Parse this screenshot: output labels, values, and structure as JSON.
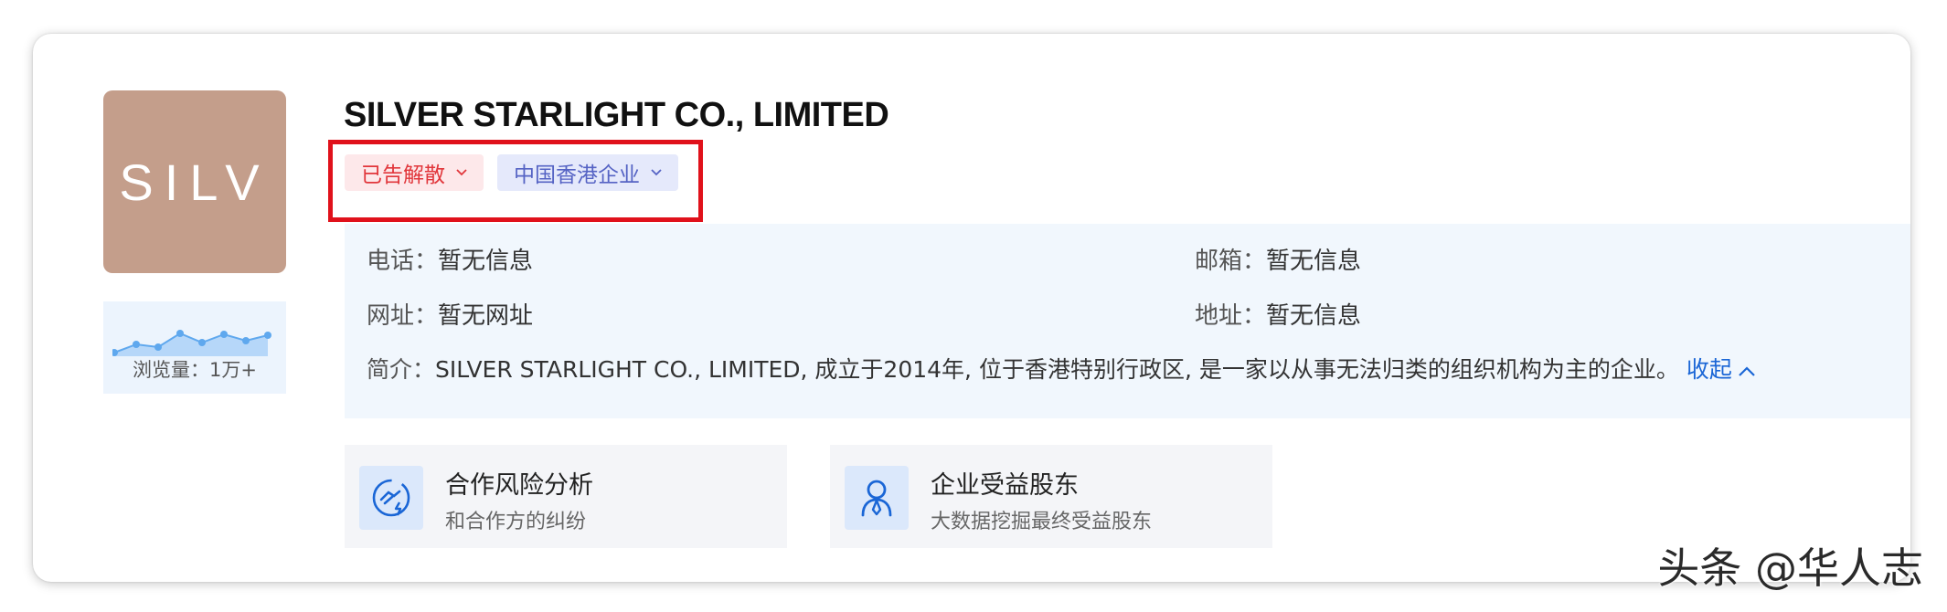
{
  "logo": {
    "text": "SILV",
    "color": "#c49e8b"
  },
  "views": {
    "label": "浏览量：1万+",
    "sparkline_points": [
      3,
      6,
      5,
      10,
      7,
      10,
      8,
      9
    ]
  },
  "company": {
    "name": "SILVER STARLIGHT CO., LIMITED"
  },
  "tags": [
    {
      "label": "已告解散",
      "color": "#e1363b",
      "icon": "chevron-down-icon"
    },
    {
      "label": "中国香港企业",
      "color": "#5563c4",
      "icon": "chevron-down-icon"
    }
  ],
  "info": {
    "phone_label": "电话：",
    "phone_value": "暂无信息",
    "email_label": "邮箱：",
    "email_value": "暂无信息",
    "website_label": "网址：",
    "website_value": "暂无网址",
    "address_label": "地址：",
    "address_value": "暂无信息",
    "intro_label": "简介：",
    "intro_value": "SILVER STARLIGHT CO., LIMITED, 成立于2014年, 位于香港特别行政区, 是一家以从事无法归类的组织机构为主的企业。",
    "collapse_label": "收起"
  },
  "features": [
    {
      "title": "合作风险分析",
      "subtitle": "和合作方的纠纷",
      "icon": "handshake-lightning-icon"
    },
    {
      "title": "企业受益股东",
      "subtitle": "大数据挖掘最终受益股东",
      "icon": "person-tie-icon"
    }
  ],
  "watermark": "头条 @华人志"
}
